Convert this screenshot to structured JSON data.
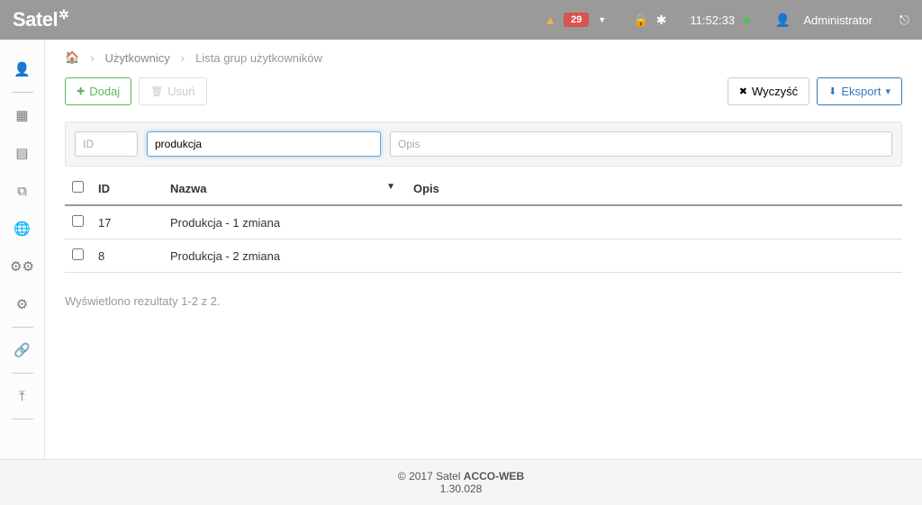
{
  "brand": "Satel",
  "topbar": {
    "alerts": "29",
    "time": "11:52:33",
    "username": "Administrator"
  },
  "breadcrumb": {
    "level1": "Użytkownicy",
    "level2": "Lista grup użytkowników"
  },
  "buttons": {
    "add": "Dodaj",
    "delete": "Usuń",
    "clear": "Wyczyść",
    "export": "Eksport"
  },
  "filters": {
    "id_placeholder": "ID",
    "name_value": "produkcja",
    "opis_placeholder": "Opis"
  },
  "columns": {
    "id": "ID",
    "name": "Nazwa",
    "opis": "Opis"
  },
  "rows": [
    {
      "id": "17",
      "name": "Produkcja - 1 zmiana",
      "opis": ""
    },
    {
      "id": "8",
      "name": "Produkcja - 2 zmiana",
      "opis": ""
    }
  ],
  "results_text": "Wyświetlono rezultaty 1-2 z 2.",
  "footer": {
    "line1_prefix": "© 2017 Satel ",
    "line1_bold": "ACCO-WEB",
    "version": "1.30.028"
  }
}
